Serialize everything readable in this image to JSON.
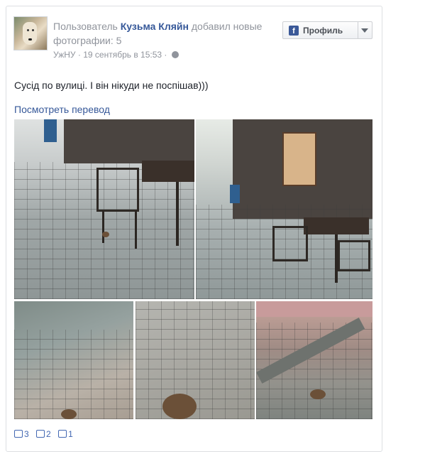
{
  "header": {
    "prefix": "Пользователь ",
    "author": "Кузьма Кляйн",
    "action": " добавил новые фотографии: 5",
    "location": "УжНУ",
    "sep": " · ",
    "timestamp": "19 сентябрь в 15:53",
    "sep2": " · "
  },
  "profile_button": {
    "label": "Профиль",
    "icon": "f"
  },
  "post": {
    "text": "Сусід по вулиці. І він нікуди не поспішав)))",
    "translate_link": "Посмотреть перевод"
  },
  "footer": {
    "likes": "3",
    "comments": "2",
    "shares": "1"
  },
  "icons": [
    "avatar",
    "facebook-icon",
    "dropdown-caret-icon",
    "globe-icon",
    "like-icon",
    "comment-icon",
    "share-icon"
  ],
  "colors": {
    "link": "#365899",
    "meta": "#90949c",
    "text": "#1d2129",
    "accent": "#4267b2"
  }
}
